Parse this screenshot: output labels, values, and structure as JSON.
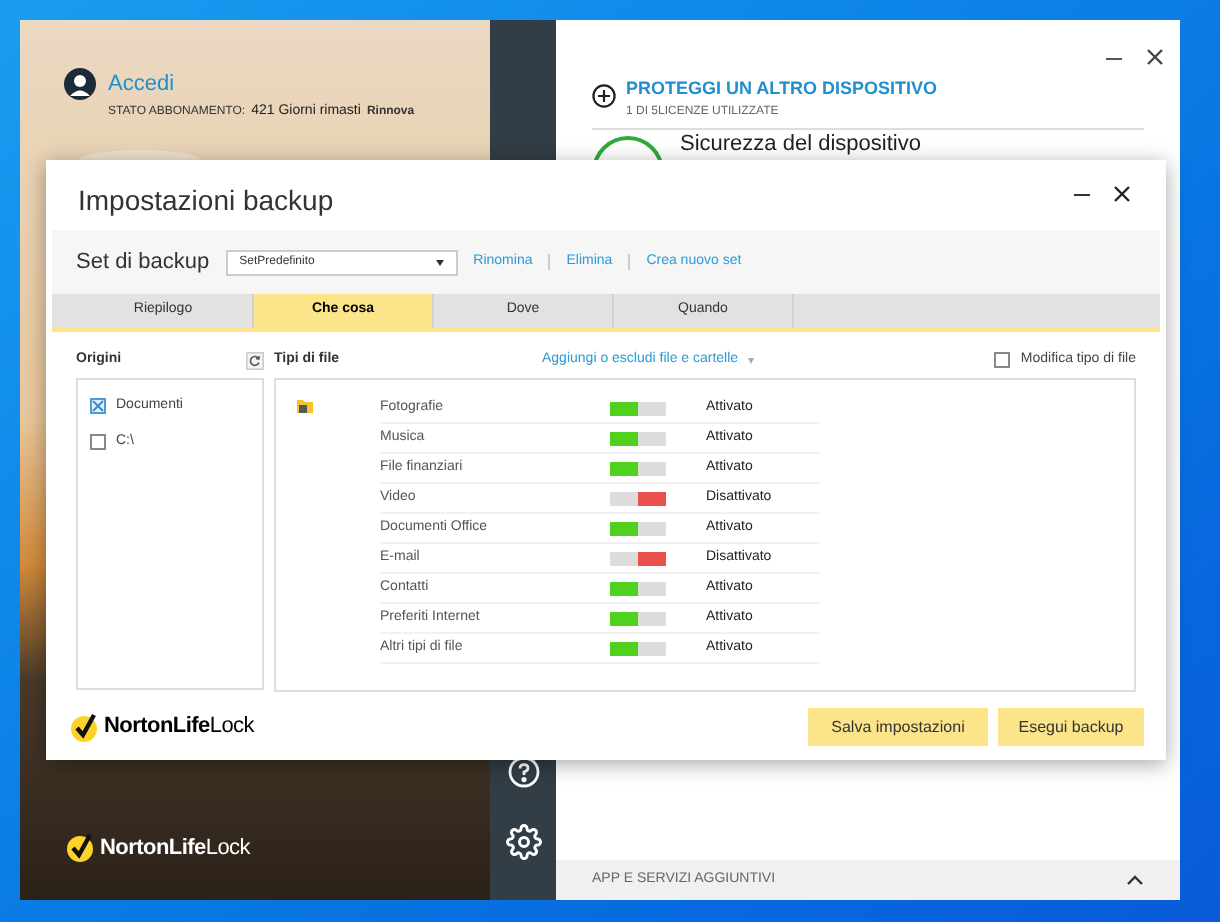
{
  "main_window": {
    "account": {
      "link": "Accedi",
      "status_label": "STATO ABBONAMENTO:",
      "status_value": "421 Giorni rimasti",
      "renew": "Rinnova"
    },
    "brand": "**NortonLife**Lock",
    "protect": {
      "title": "PROTEGGI UN ALTRO DISPOSITIVO",
      "subtitle": "1 DI 5LICENZE UTILIZZATE"
    },
    "device_security": "Sicurezza del dispositivo",
    "footer": "APP E SERVIZI AGGIUNTIVI"
  },
  "dialog": {
    "title": "Impostazioni backup",
    "set_label": "Set di backup",
    "set_value": "SetPredefinito",
    "links": [
      "Rinomina",
      "Elimina",
      "Crea nuovo set"
    ],
    "tabs": [
      {
        "label": "Riepilogo",
        "selected": false
      },
      {
        "label": "Che cosa",
        "selected": true
      },
      {
        "label": "Dove",
        "selected": false
      },
      {
        "label": "Quando",
        "selected": false
      }
    ],
    "origins": {
      "label": "Origini",
      "items": [
        {
          "label": "Documenti",
          "checked": true
        },
        {
          "label": "C:\\",
          "checked": false
        }
      ]
    },
    "file_types": {
      "label": "Tipi di file",
      "add_link": "Aggiungi o escludi file e cartelle",
      "modify": {
        "label": "Modifica tipo di file",
        "checked": false
      },
      "rows": [
        {
          "name": "Fotografie",
          "on": true,
          "status": "Attivato"
        },
        {
          "name": "Musica",
          "on": true,
          "status": "Attivato"
        },
        {
          "name": "File finanziari",
          "on": true,
          "status": "Attivato"
        },
        {
          "name": "Video",
          "on": false,
          "status": "Disattivato"
        },
        {
          "name": "Documenti Office",
          "on": true,
          "status": "Attivato"
        },
        {
          "name": "E-mail",
          "on": false,
          "status": "Disattivato"
        },
        {
          "name": "Contatti",
          "on": true,
          "status": "Attivato"
        },
        {
          "name": "Preferiti Internet",
          "on": true,
          "status": "Attivato"
        },
        {
          "name": "Altri tipi di file",
          "on": true,
          "status": "Attivato"
        }
      ]
    },
    "brand": "**NortonLife**Lock",
    "buttons": [
      "Salva impostazioni",
      "Esegui backup"
    ]
  }
}
